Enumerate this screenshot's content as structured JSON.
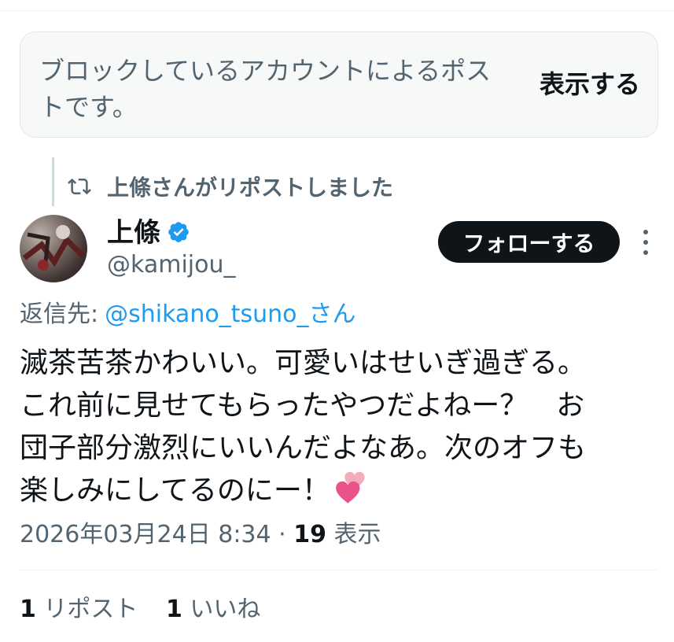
{
  "blocked": {
    "message": "ブロックしているアカウントによるポストです。",
    "show_label": "表示する"
  },
  "repost": {
    "label": "上條さんがリポストしました"
  },
  "author": {
    "name": "上條",
    "handle": "@kamijou_",
    "verified": true
  },
  "follow_label": "フォローする",
  "reply": {
    "prefix": "返信先",
    "separator": ":",
    "target": "@shikano_tsuno_さん"
  },
  "post": {
    "text": "滅茶苦茶かわいい。可愛いはせいぎ過ぎる。\nこれ前に見せてもらったやつだよねー？　お\n団子部分激烈にいいんだよなあ。次のオフも\n楽しみにしてるのにー！",
    "emoji": "two-hearts"
  },
  "meta": {
    "datetime": "2026年03月24日 8:34",
    "separator": " · ",
    "views_count": "19",
    "views_label": " 表示"
  },
  "stats": {
    "reposts_count": "1",
    "reposts_label": " リポスト",
    "likes_count": "1",
    "likes_label": " いいね"
  },
  "colors": {
    "link": "#1d9bf0",
    "verified": "#1d9bf0",
    "muted_text": "#536471",
    "primary_text": "#0f1419",
    "follow_button_bg": "#0f1419"
  }
}
